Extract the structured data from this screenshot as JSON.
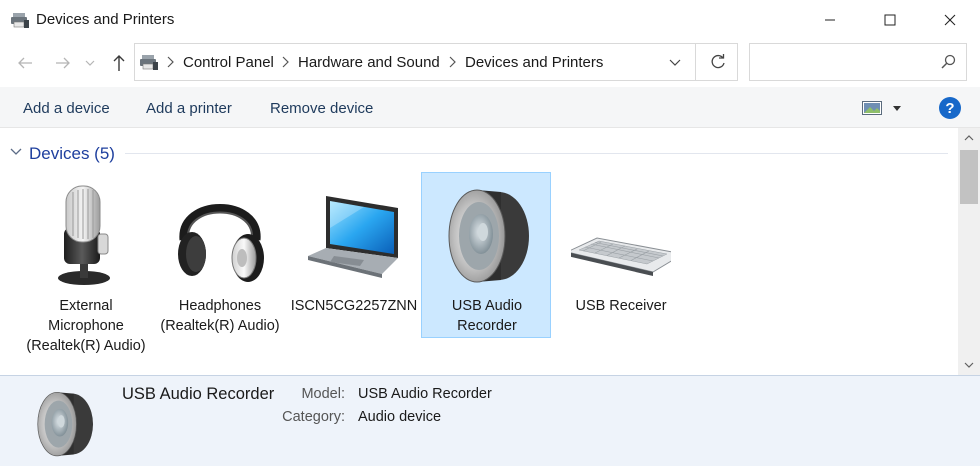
{
  "window": {
    "title": "Devices and Printers"
  },
  "address": {
    "breadcrumbs": [
      "Control Panel",
      "Hardware and Sound",
      "Devices and Printers"
    ],
    "search_placeholder": ""
  },
  "toolbar": {
    "add_device": "Add a device",
    "add_printer": "Add a printer",
    "remove_device": "Remove device"
  },
  "group": {
    "title": "Devices (5)"
  },
  "devices": [
    {
      "label": "External Microphone (Realtek(R) Audio)",
      "icon": "microphone-icon",
      "selected": false
    },
    {
      "label": "Headphones (Realtek(R) Audio)",
      "icon": "headphones-icon",
      "selected": false
    },
    {
      "label": "ISCN5CG2257ZNN",
      "icon": "laptop-icon",
      "selected": false
    },
    {
      "label": "USB Audio Recorder",
      "icon": "speaker-icon",
      "selected": true
    },
    {
      "label": "USB Receiver",
      "icon": "keyboard-icon",
      "selected": false
    }
  ],
  "details": {
    "name": "USB Audio Recorder",
    "model_key": "Model:",
    "model_value": "USB Audio Recorder",
    "category_key": "Category:",
    "category_value": "Audio device"
  },
  "colors": {
    "selection": "#cce8ff",
    "selection_border": "#99d1ff",
    "link": "#1e3f9e",
    "help": "#1768c9"
  }
}
